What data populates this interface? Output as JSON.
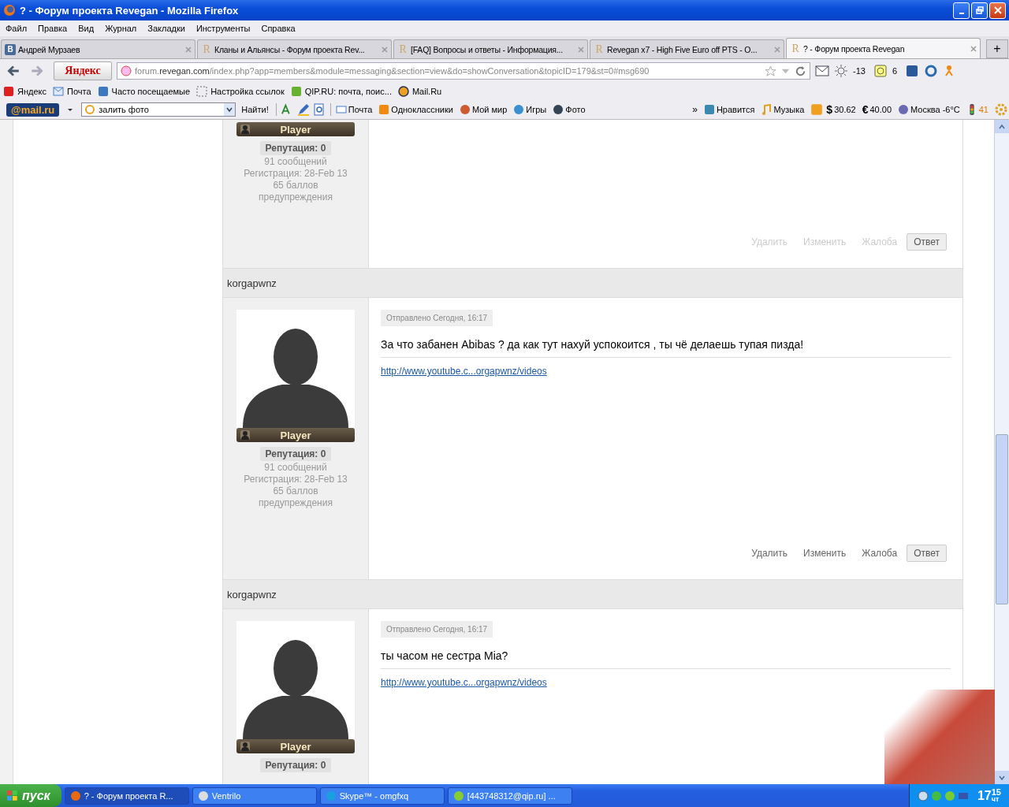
{
  "window": {
    "title": "? - Форум проекта Revegan - Mozilla Firefox"
  },
  "menu": [
    "Файл",
    "Правка",
    "Вид",
    "Журнал",
    "Закладки",
    "Инструменты",
    "Справка"
  ],
  "tabs": [
    {
      "label": "Андрей Мурзаев",
      "kind": "vk",
      "icon_letter": "В",
      "selected": false
    },
    {
      "label": "Кланы и Альянсы - Форум проекта Rev...",
      "kind": "site",
      "icon_letter": "R",
      "selected": false
    },
    {
      "label": "[FAQ] Вопросы и ответы - Информация...",
      "kind": "site",
      "icon_letter": "R",
      "selected": false
    },
    {
      "label": "Revegan x7 - High Five Euro off PTS - O...",
      "kind": "site",
      "icon_letter": "R",
      "selected": false
    },
    {
      "label": "? - Форум проекта Revegan",
      "kind": "site",
      "icon_letter": "R",
      "selected": true
    }
  ],
  "new_tab": "+",
  "navbar": {
    "yandex": "Яндекс",
    "url": {
      "prefix": "forum.",
      "domain": "revegan.com",
      "path": "/index.php?app=members&module=messaging&section=view&do=showConversation&topicID=179&st=0#msg690"
    },
    "weather": "-13",
    "counter": "6"
  },
  "bookmarks": [
    {
      "label": "Яндекс",
      "kind": "yandex"
    },
    {
      "label": "Почта",
      "kind": "mail"
    },
    {
      "label": "Часто посещаемые",
      "kind": "search"
    },
    {
      "label": "Настройка ссылок",
      "kind": "dashed"
    },
    {
      "label": "QIP.RU: почта, поис...",
      "kind": "qip"
    },
    {
      "label": "Mail.Ru",
      "kind": "at"
    }
  ],
  "mailru": {
    "logo": "@mail.ru",
    "search": "залить фото",
    "find": "Найти!",
    "links": [
      {
        "label": "Почта",
        "kind": "mail"
      },
      {
        "label": "Одноклассники",
        "kind": "ok"
      },
      {
        "label": "Мой мир",
        "kind": "world"
      },
      {
        "label": "Игры",
        "kind": "games"
      },
      {
        "label": "Фото",
        "kind": "photo"
      }
    ],
    "more": "»",
    "right": [
      {
        "label": "Нравится",
        "kind": "like"
      },
      {
        "label": "Музыка",
        "kind": "music"
      },
      {
        "kind": "box"
      },
      {
        "kind": "currency",
        "symbol": "$",
        "label": "30.62"
      },
      {
        "kind": "currency",
        "symbol": "€",
        "label": "40.00"
      },
      {
        "label": "Москва -6°C",
        "kind": "weather"
      },
      {
        "label": "41",
        "kind": "traffic"
      },
      {
        "kind": "gear"
      }
    ]
  },
  "posts": [
    {
      "stats": {
        "group": "Player",
        "reputation": "Репутация: 0",
        "lines": [
          "91 сообщений",
          "Регистрация: 28-Feb 13",
          "65 баллов",
          "предупреждения"
        ]
      },
      "actions": [
        {
          "label": "Удалить",
          "kind": "link",
          "disabled": true
        },
        {
          "label": "Изменить",
          "kind": "link",
          "disabled": true
        },
        {
          "label": "Жалоба",
          "kind": "link",
          "disabled": true
        },
        {
          "label": "Ответ",
          "kind": "button",
          "disabled": false
        }
      ]
    },
    {
      "author": "korgapwnz",
      "date": "Отправлено Сегодня, 16:17",
      "message": "За что забанен Abibas ? да как тут нахуй успокоится , ты чё делаешь тупая пизда!",
      "link": "http://www.youtube.c...orgapwnz/videos",
      "stats": {
        "group": "Player",
        "reputation": "Репутация: 0",
        "lines": [
          "91 сообщений",
          "Регистрация: 28-Feb 13",
          "65 баллов",
          "предупреждения"
        ]
      },
      "actions": [
        {
          "label": "Удалить",
          "kind": "link",
          "disabled": false
        },
        {
          "label": "Изменить",
          "kind": "link",
          "disabled": false
        },
        {
          "label": "Жалоба",
          "kind": "link",
          "disabled": false
        },
        {
          "label": "Ответ",
          "kind": "button",
          "disabled": false
        }
      ]
    },
    {
      "author": "korgapwnz",
      "date": "Отправлено Сегодня, 16:17",
      "message": "ты часом не сестра Mia?",
      "link": "http://www.youtube.c...orgapwnz/videos",
      "stats": {
        "group": "Player",
        "reputation": "Репутация: 0"
      }
    }
  ],
  "taskbar": {
    "start": "пуск",
    "tasks": [
      {
        "label": "? - Форум проекта R...",
        "kind": "firefox",
        "selected": true
      },
      {
        "label": "Ventrilo",
        "kind": "ventrilo",
        "selected": false
      },
      {
        "label": "Skype™ - omgfxq",
        "kind": "skype",
        "selected": false
      },
      {
        "label": "[443748312@qip.ru] ...",
        "kind": "qip",
        "selected": false
      }
    ],
    "clock": {
      "hour": "17",
      "minute": "15",
      "day": "чт"
    }
  }
}
